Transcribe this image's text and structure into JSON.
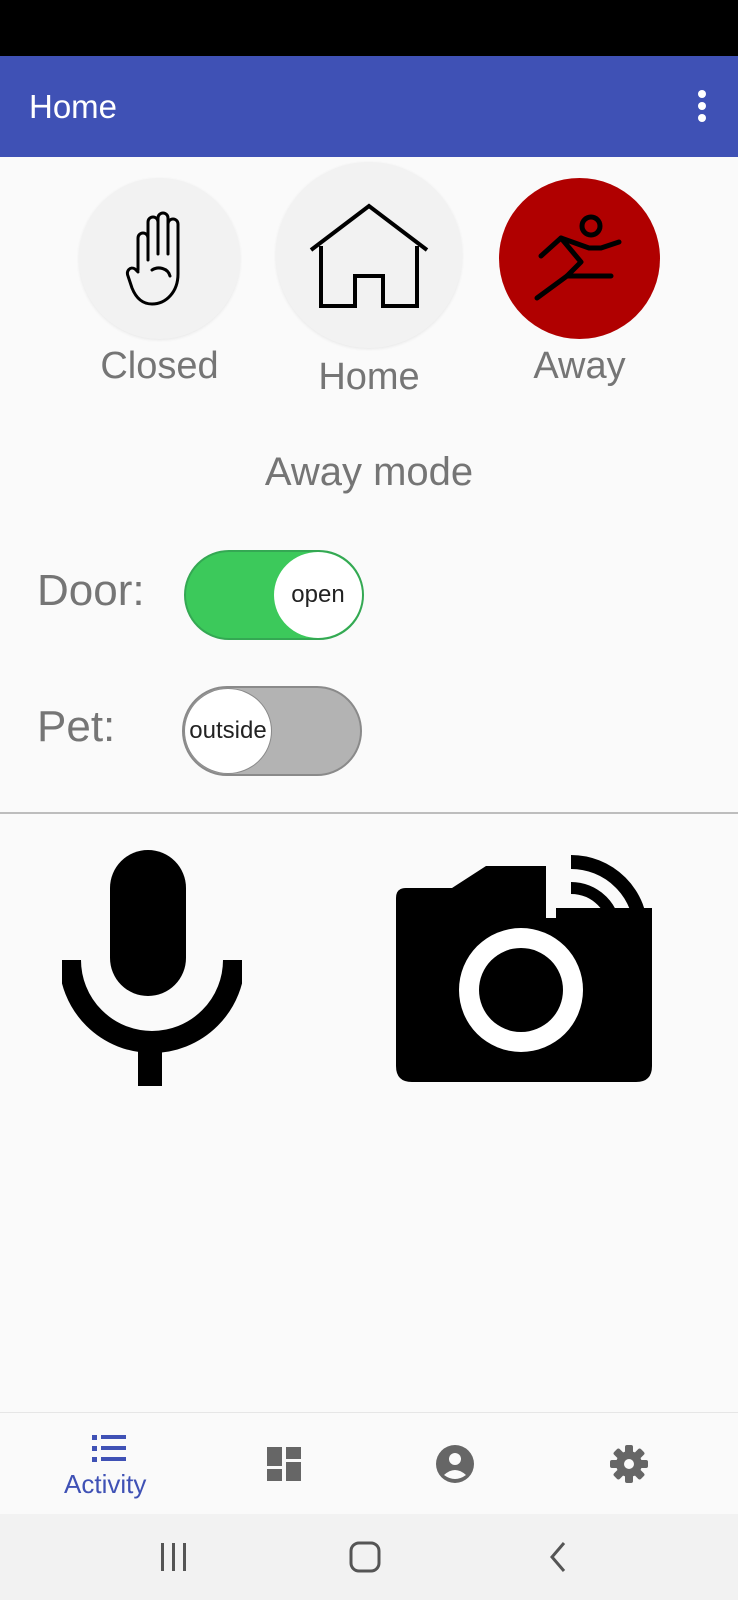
{
  "app_bar": {
    "title": "Home",
    "menu_icon": "more-vert-icon"
  },
  "modes": [
    {
      "label": "Closed",
      "icon": "raised-hand-icon",
      "selected": false
    },
    {
      "label": "Home",
      "icon": "house-icon",
      "selected": false
    },
    {
      "label": "Away",
      "icon": "running-person-icon",
      "selected": true,
      "color": "#b00000"
    }
  ],
  "mode_title": "Away mode",
  "door": {
    "label": "Door:",
    "state": "open",
    "on": true,
    "color": "#3cc95b"
  },
  "pet": {
    "label": "Pet:",
    "state": "outside",
    "on": false,
    "color": "#b3b3b3"
  },
  "actions": [
    {
      "icon": "microphone-icon"
    },
    {
      "icon": "camera-stream-icon"
    }
  ],
  "bottom_nav": [
    {
      "label": "Activity",
      "icon": "list-icon",
      "active": true
    },
    {
      "icon": "dashboard-icon"
    },
    {
      "icon": "account-circle-icon"
    },
    {
      "icon": "settings-icon"
    }
  ],
  "system_nav": [
    "recent-apps-icon",
    "home-circle-icon",
    "back-icon"
  ],
  "colors": {
    "primary": "#3f51b5",
    "away": "#b00000",
    "toggle_on": "#3cc95b"
  }
}
